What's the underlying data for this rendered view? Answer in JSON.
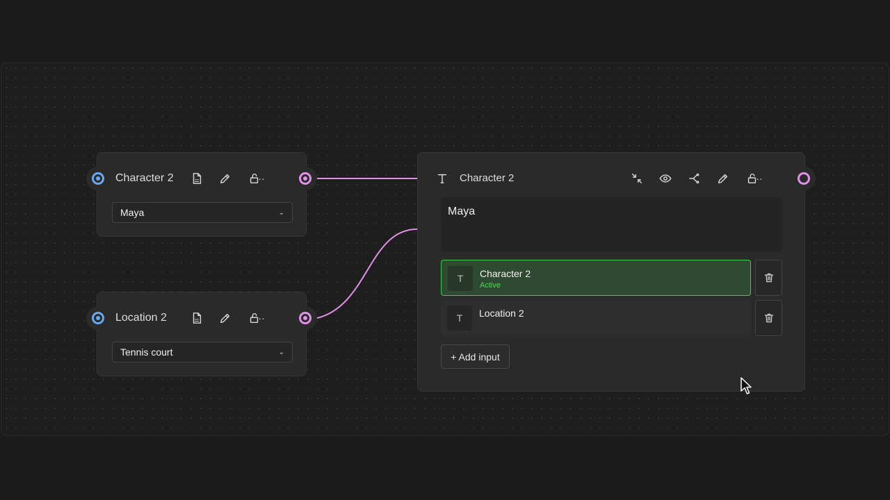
{
  "nodes": {
    "char_node": {
      "title": "Character 2",
      "select_value": "Maya"
    },
    "loc_node": {
      "title": "Location 2",
      "select_value": "Tennis court"
    },
    "combine_node": {
      "title": "Character 2",
      "text_value": "Maya",
      "inputs": [
        {
          "label": "Character 2",
          "status": "Active",
          "type_icon": "T"
        },
        {
          "label": "Location 2",
          "status": "",
          "type_icon": "T"
        }
      ],
      "add_input_label": "+ Add input"
    }
  },
  "colors": {
    "input_port": "#6aa8f0",
    "output_port": "#e291e8",
    "active_border": "#3ccb4a",
    "active_text": "#4bdc57",
    "wire": "#e291e8"
  },
  "icons": {
    "csv": "csv-file-icon",
    "pen": "pen-icon",
    "lock": "unlock-icon",
    "more": "more-icon",
    "text": "text-type-icon",
    "collapse": "collapse-icon",
    "eye": "eye-icon",
    "branch": "branch-icon",
    "trash": "trash-icon"
  }
}
